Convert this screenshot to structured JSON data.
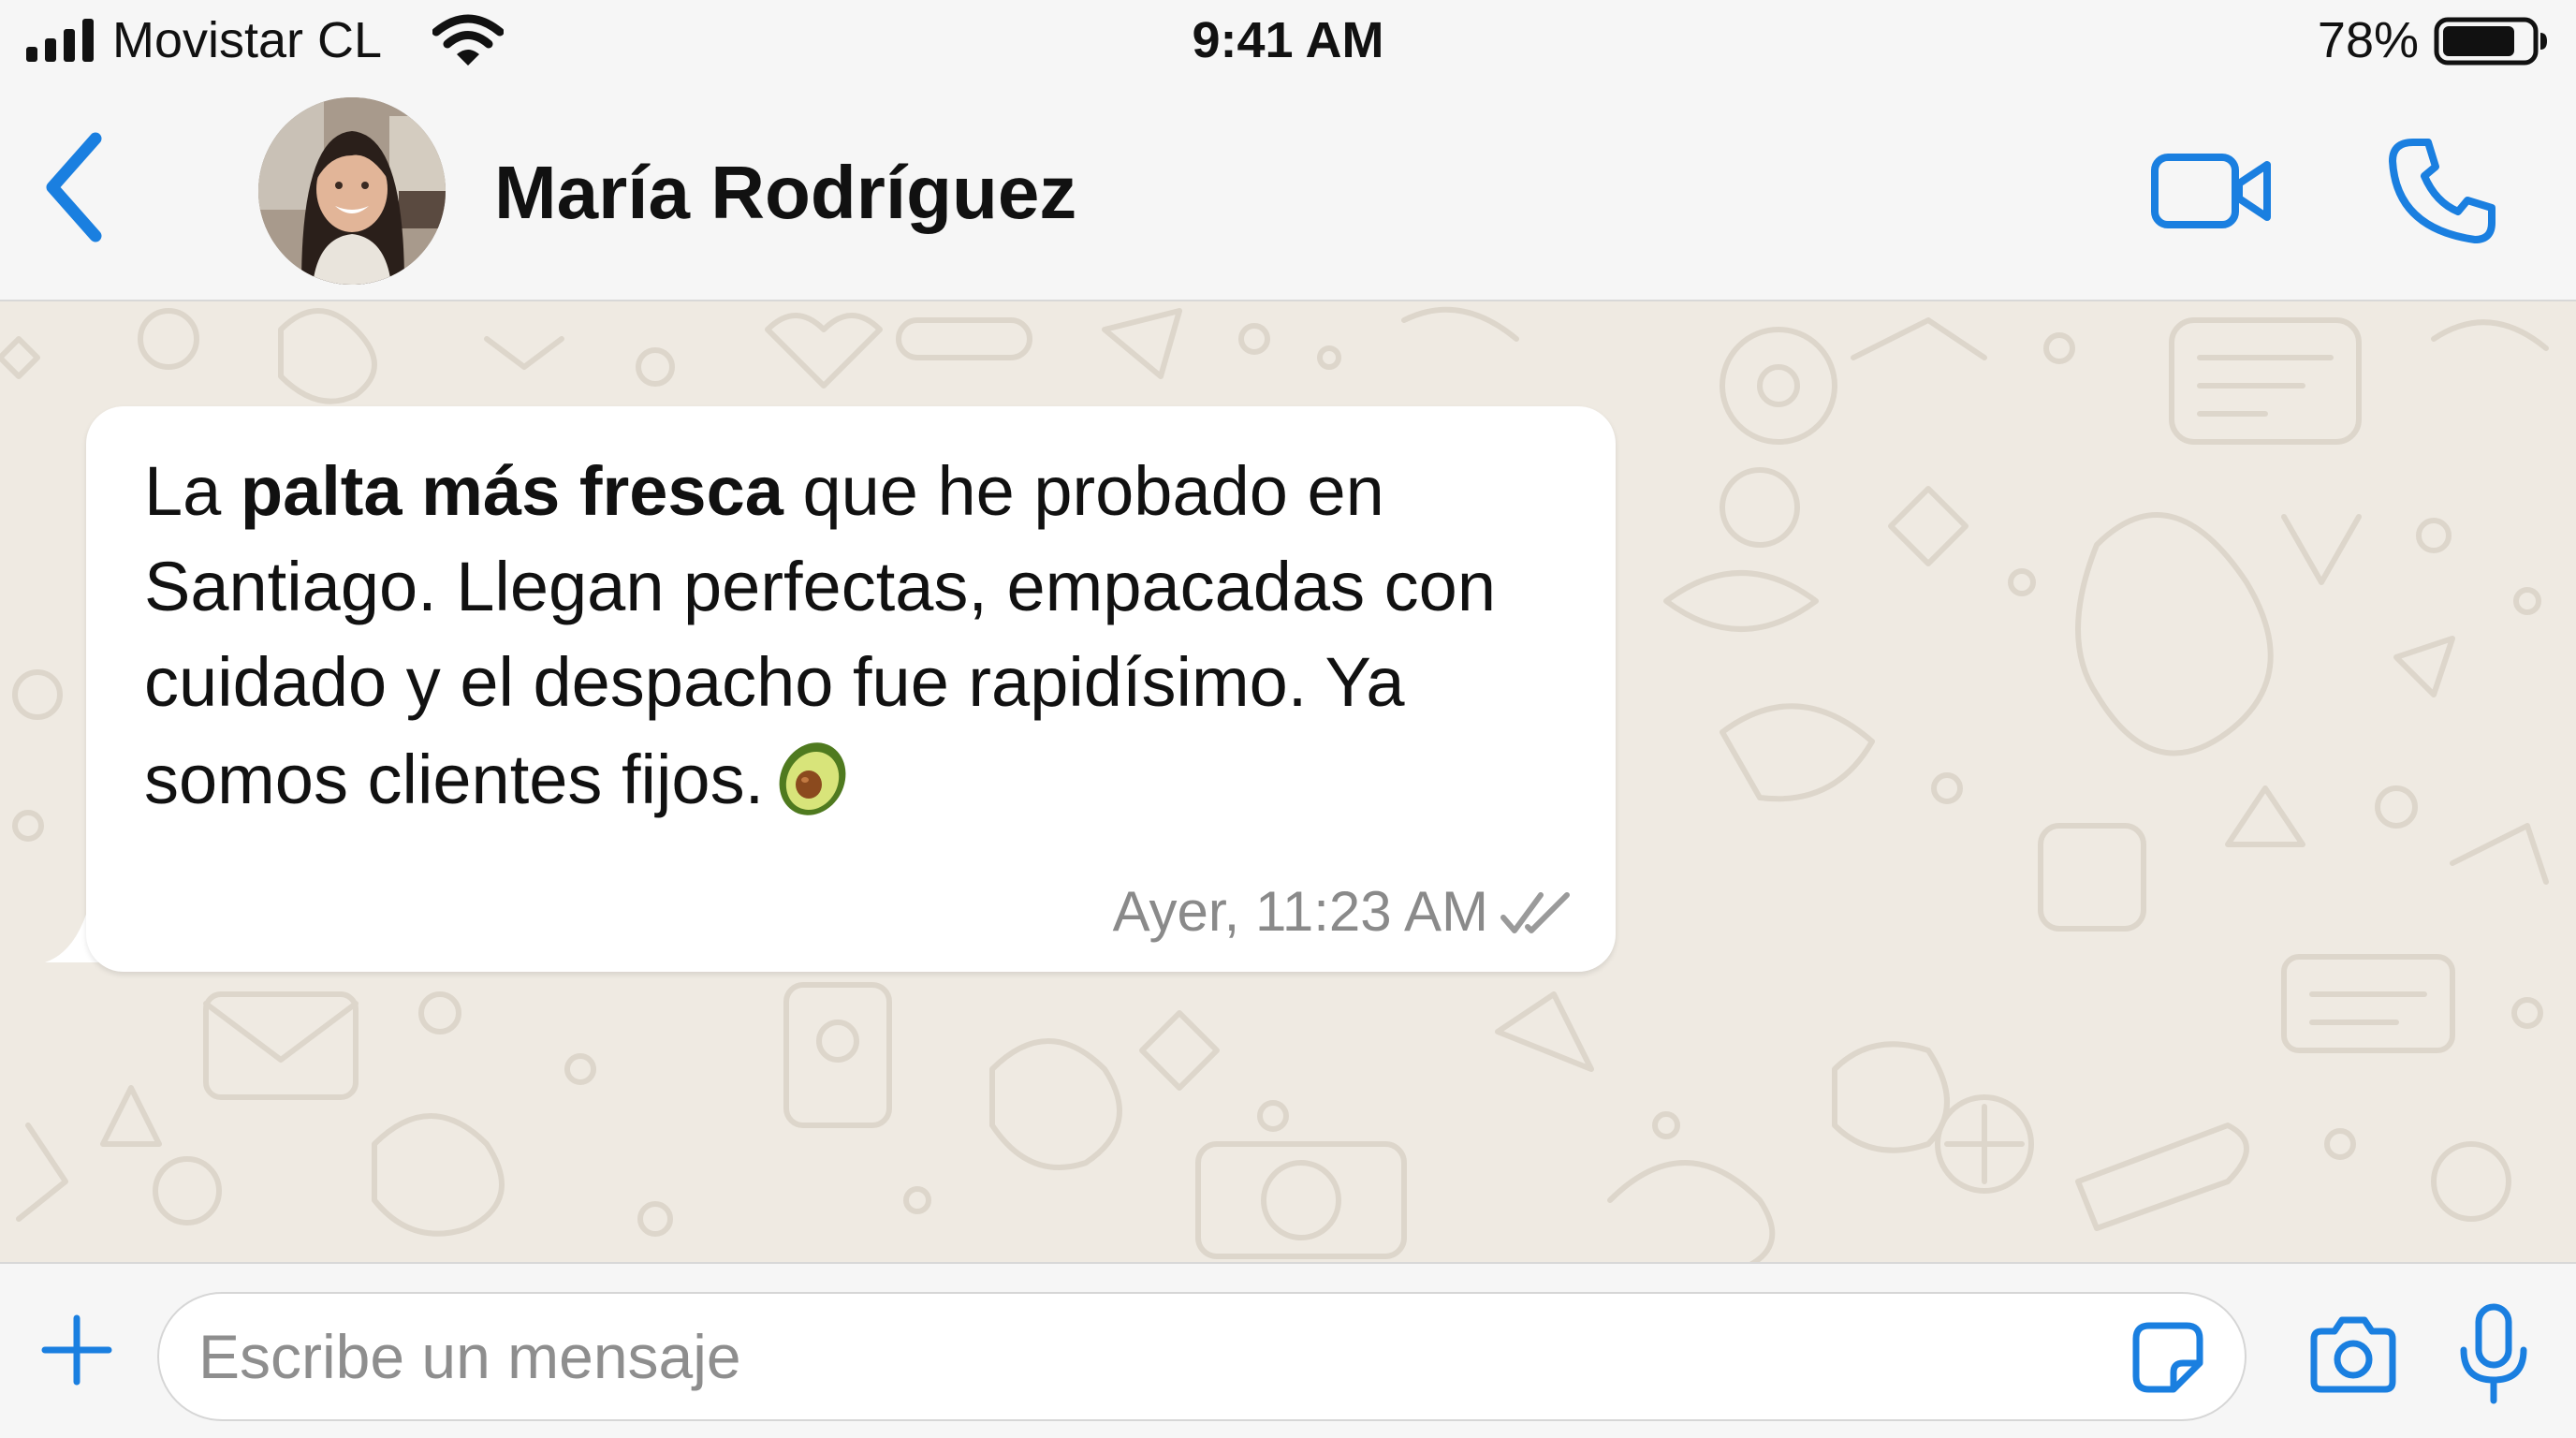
{
  "status_bar": {
    "carrier": "Movistar CL",
    "time": "9:41 AM",
    "battery_percent": "78%",
    "icons": [
      "signal-bars-icon",
      "wifi-icon",
      "battery-icon"
    ]
  },
  "header": {
    "contact_name": "María Rodríguez",
    "icons": [
      "back-chevron-icon",
      "avatar",
      "video-call-icon",
      "phone-call-icon"
    ]
  },
  "message": {
    "text_before_bold": "La ",
    "text_bold": "palta más fresca",
    "text_after_bold": " que he probado en Santiago. Llegan perfectas, empacadas con cuidado y el despacho fue rapidísimo. Ya somos clientes fijos.",
    "emoji": "avocado-icon",
    "timestamp": "Ayer, 11:23 AM",
    "status_icon": "double-check-icon"
  },
  "input_bar": {
    "placeholder": "Escribe un mensaje",
    "value": "",
    "icons": [
      "plus-icon",
      "sticker-icon",
      "camera-icon",
      "microphone-icon"
    ]
  },
  "colors": {
    "accent": "#1a7fe0",
    "chat_background": "#efeae2",
    "bubble": "#ffffff",
    "bars": "#f6f6f6",
    "timestamp": "#8a8a8a"
  }
}
